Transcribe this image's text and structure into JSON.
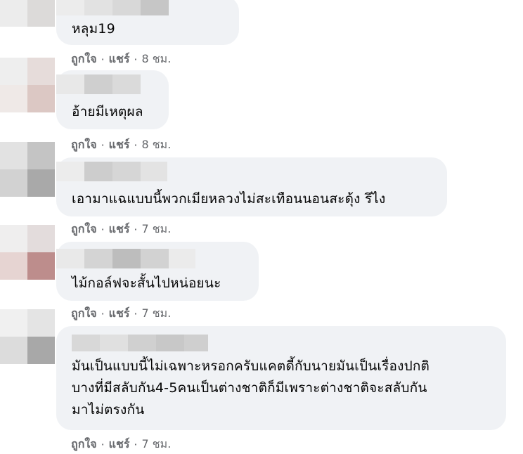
{
  "comments": [
    {
      "text": "หลุม19",
      "like": "ถูกใจ",
      "share": "แชร์",
      "time": "8 ชม."
    },
    {
      "text": "อ้ายมีเหตุผล",
      "like": "ถูกใจ",
      "share": "แชร์",
      "time": "8 ชม."
    },
    {
      "text": "เอามาแฉแบบนี้พวกเมียหลวงไม่สะเทือนนอนสะดุ้ง รึไง",
      "like": "ถูกใจ",
      "share": "แชร์",
      "time": "7 ชม."
    },
    {
      "text": "ไม้กอล์ฟจะสั้นไปหน่อยนะ",
      "like": "ถูกใจ",
      "share": "แชร์",
      "time": "7 ชม."
    },
    {
      "text": "มันเป็นแบบนี้ไม่เฉพาะหรอกครับแคตดี้กับนายมันเป็นเรื่องปกติ\nบางที่มีสลับกัน4-5คนเป็นต่างชาติก็มีเพราะต่างชาติจะสลับกัน\nมาไม่ตรงกัน",
      "like": "ถูกใจ",
      "share": "แชร์",
      "time": "7 ชม."
    }
  ],
  "separator": "·"
}
